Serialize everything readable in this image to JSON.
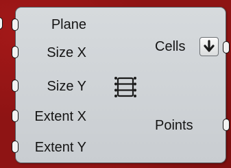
{
  "component": {
    "inputs": [
      {
        "label": "Plane"
      },
      {
        "label": "Size X"
      },
      {
        "label": "Size Y"
      },
      {
        "label": "Extent X"
      },
      {
        "label": "Extent Y"
      }
    ],
    "outputs": [
      {
        "label": "Cells",
        "flag_icon": "down-arrow-icon"
      },
      {
        "label": "Points"
      }
    ],
    "center_icon": "grid-cells-icon"
  },
  "colors": {
    "canvas": "#8e1414",
    "component_fill": "#d0d4d8",
    "component_border": "#5a5e62",
    "text": "#141414"
  }
}
